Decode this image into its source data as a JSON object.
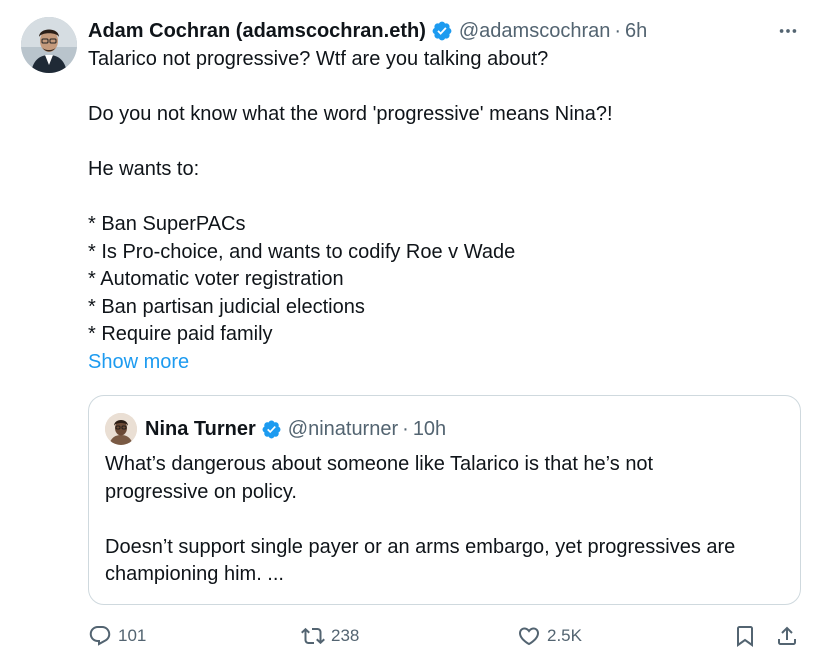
{
  "author": {
    "name": "Adam Cochran (adamscochran.eth)",
    "handle": "@adamscochran",
    "time": "6h"
  },
  "tweet": {
    "paragraphs": [
      "Talarico not progressive? Wtf are you talking about?",
      "",
      "Do you not know what the word 'progressive' means Nina?!",
      "",
      "He wants to:",
      "",
      "* Ban SuperPACs",
      "* Is Pro-choice, and wants to codify Roe v Wade",
      "* Automatic voter registration",
      "* Ban partisan judicial elections",
      "* Require paid family"
    ],
    "show_more": "Show more"
  },
  "quote": {
    "name": "Nina Turner",
    "handle": "@ninaturner",
    "time": "10h",
    "paragraphs": [
      "What’s dangerous about someone like Talarico is that he’s not",
      "progressive on policy.",
      "",
      "Doesn’t support single payer or an arms embargo, yet progressives are",
      "championing him. ..."
    ]
  },
  "actions": {
    "replies": "101",
    "reposts": "238",
    "likes": "2.5K"
  },
  "separator": "·",
  "colors": {
    "accent": "#1d9bf0",
    "muted": "#536471",
    "border": "#cfd9de",
    "text": "#0f1419"
  },
  "icons": [
    "verified-badge-icon",
    "more-icon",
    "reply-icon",
    "repost-icon",
    "like-icon",
    "bookmark-icon",
    "share-icon"
  ]
}
